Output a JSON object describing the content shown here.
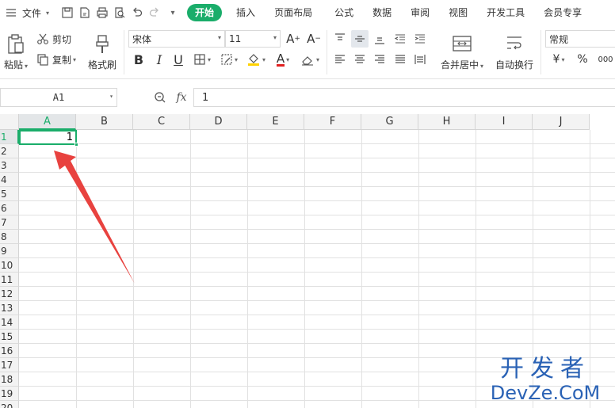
{
  "menubar": {
    "file_label": "文件",
    "tabs": [
      "开始",
      "插入",
      "页面布局",
      "公式",
      "数据",
      "审阅",
      "视图",
      "开发工具",
      "会员专享"
    ],
    "active_tab": "开始"
  },
  "ribbon": {
    "paste_label": "粘贴",
    "cut_label": "剪切",
    "copy_label": "复制",
    "format_painter_label": "格式刷",
    "font_name": "宋体",
    "font_size": "11",
    "merge_center_label": "合并居中",
    "wrap_text_label": "自动换行",
    "number_format": "常规",
    "currency_symbol": "¥",
    "percent_symbol": "%",
    "thousands_symbol": "000"
  },
  "formula_bar": {
    "cell_reference": "A1",
    "fx_label": "fx",
    "formula_value": "1"
  },
  "sheet": {
    "columns": [
      "A",
      "B",
      "C",
      "D",
      "E",
      "F",
      "G",
      "H",
      "I",
      "J"
    ],
    "rows": [
      "1",
      "2",
      "3",
      "4",
      "5",
      "6",
      "7",
      "8",
      "9",
      "10",
      "11",
      "12",
      "13",
      "14",
      "15",
      "16",
      "17",
      "18",
      "19",
      "20"
    ],
    "selected_column": "A",
    "selected_row": "1",
    "cell_a1_value": "1"
  },
  "annotation": {
    "arrow_color": "#e8423f"
  },
  "watermark": {
    "line1": "开发者",
    "line2": "DevZe.CoM"
  },
  "colors": {
    "accent": "#1aad6a",
    "font_color": "#e02020",
    "fill_color": "#ffd200"
  }
}
